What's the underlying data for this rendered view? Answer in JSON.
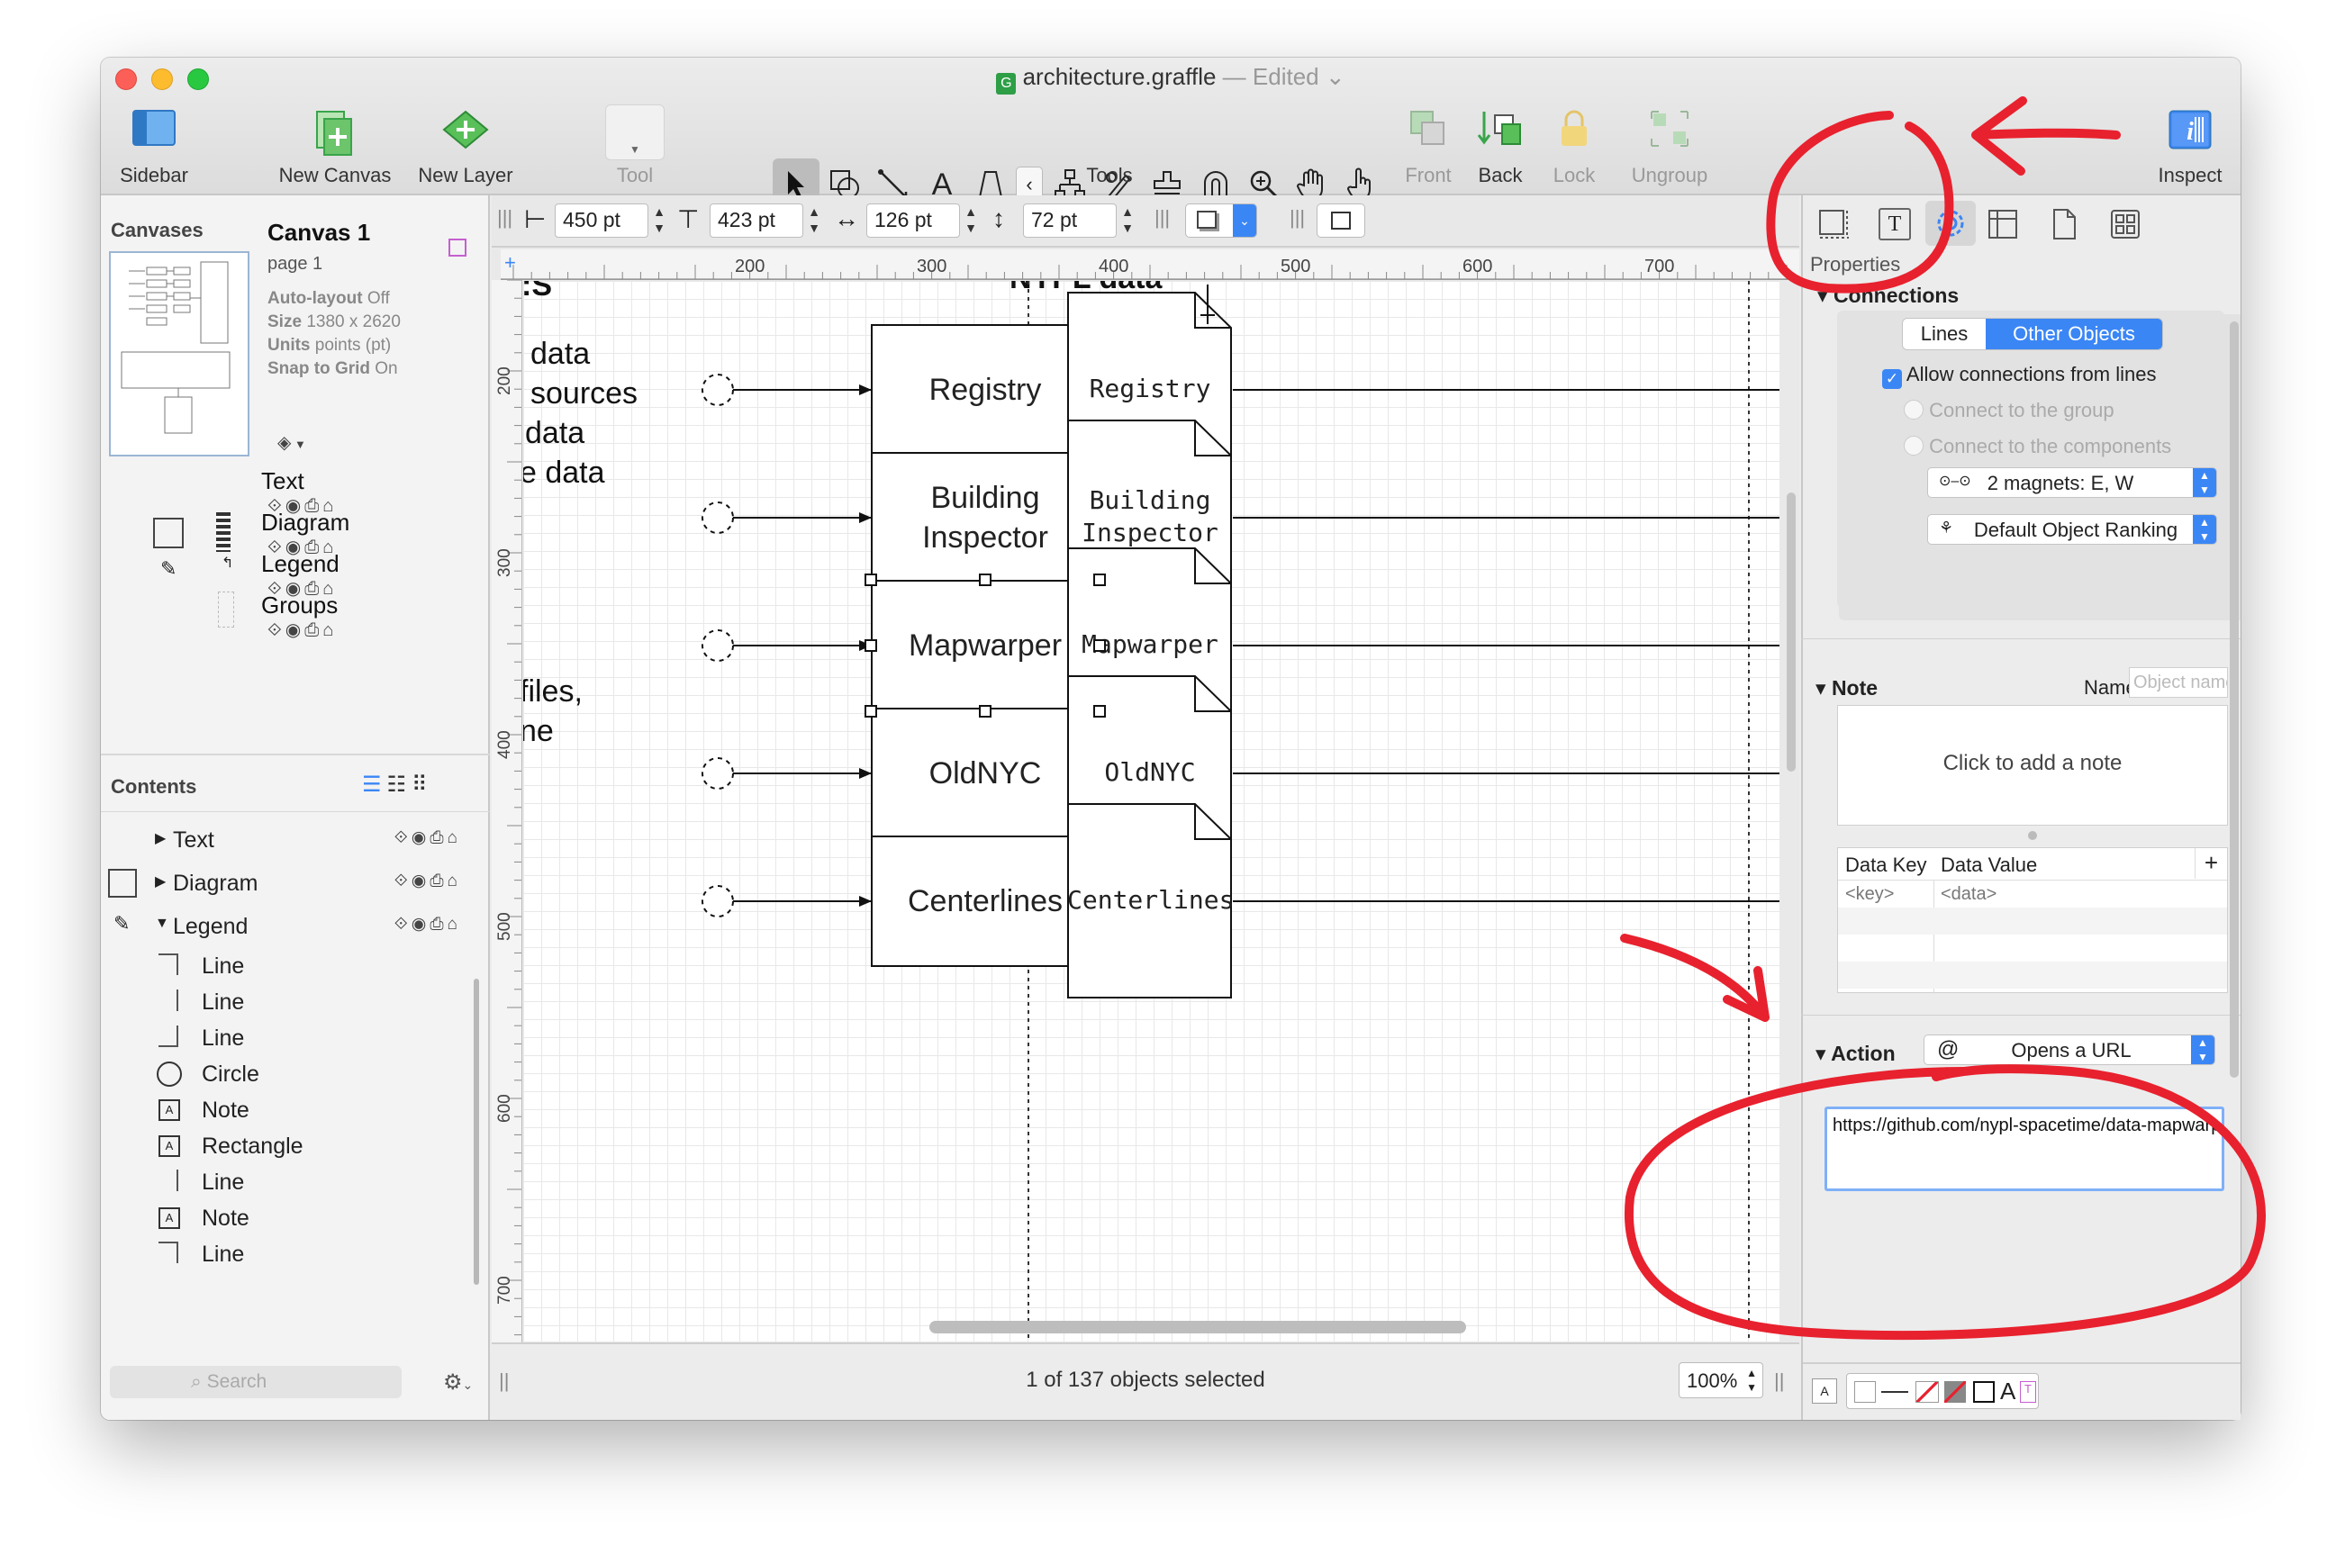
{
  "window": {
    "title": "architecture.graffle",
    "edited": "Edited"
  },
  "toolbar": {
    "sidebar": "Sidebar",
    "new_canvas": "New Canvas",
    "new_layer": "New Layer",
    "tool": "Tool",
    "tools": "Tools",
    "front": "Front",
    "back": "Back",
    "lock": "Lock",
    "ungroup": "Ungroup",
    "inspect": "Inspect"
  },
  "sidebar": {
    "canvases_title": "Canvases",
    "canvas": {
      "name": "Canvas 1",
      "page": "page 1",
      "autolayout_label": "Auto-layout",
      "autolayout_value": "Off",
      "size_label": "Size",
      "size_value": "1380 x 2620",
      "units_label": "Units",
      "units_value": "points (pt)",
      "snap_label": "Snap to Grid",
      "snap_value": "On"
    },
    "layers": [
      "Text",
      "Diagram",
      "Legend",
      "Groups"
    ],
    "contents_title": "Contents",
    "contents": {
      "groups": [
        "Text",
        "Diagram",
        "Legend"
      ],
      "items": [
        "Line",
        "Line",
        "Line",
        "Circle",
        "Note",
        "Rectangle",
        "Line",
        "Note",
        "Line"
      ]
    },
    "search_placeholder": "Search"
  },
  "geometry_bar": {
    "x": "450 pt",
    "y": "423 pt",
    "width": "126 pt",
    "height": "72 pt"
  },
  "ruler": {
    "h_ticks": [
      "200",
      "300",
      "400",
      "500",
      "600",
      "700"
    ],
    "v_ticks": [
      "200",
      "300",
      "400",
      "500",
      "600",
      "700"
    ]
  },
  "canvas": {
    "left_fragments": [
      "data",
      "sources",
      "data",
      "e data",
      "files,",
      "ne"
    ],
    "header_fragment": "NYPL data",
    "boxes": [
      "Registry",
      "Building Inspector",
      "Mapwarper",
      "OldNYC",
      "Centerlines"
    ],
    "docs": [
      "Registry",
      "Building Inspector",
      "Mapwarper",
      "OldNYC",
      "Centerlines"
    ]
  },
  "status": {
    "selection": "1 of 137 objects selected",
    "zoom": "100%"
  },
  "inspector": {
    "tab_label": "Properties",
    "connections": {
      "title": "Connections",
      "seg_lines": "Lines",
      "seg_other": "Other Objects",
      "allow": "Allow connections from lines",
      "to_group": "Connect to the group",
      "to_components": "Connect to the components",
      "magnets": "2 magnets: E, W",
      "ranking": "Default Object Ranking"
    },
    "note": {
      "title": "Note",
      "name_label": "Name:",
      "name_placeholder": "Object name",
      "click_to_add": "Click to add a note",
      "key_header": "Data Key",
      "value_header": "Data Value",
      "key_placeholder": "<key>",
      "value_placeholder": "<data>"
    },
    "action": {
      "title": "Action",
      "symbol": "@",
      "value": "Opens a URL",
      "url": "https://github.com/nypl-spacetime/data-mapwarper"
    }
  },
  "colors": {
    "accent": "#3b86f5",
    "annotation": "#e8212e"
  }
}
